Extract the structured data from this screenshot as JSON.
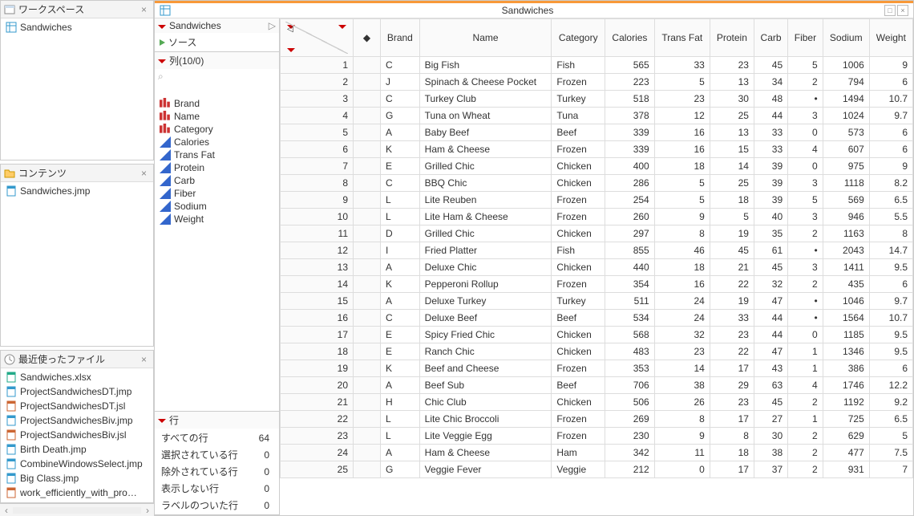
{
  "workspace": {
    "title": "ワークスペース",
    "items": [
      {
        "label": "Sandwiches"
      }
    ]
  },
  "contents": {
    "title": "コンテンツ",
    "items": [
      {
        "label": "Sandwiches.jmp"
      }
    ]
  },
  "recent": {
    "title": "最近使ったファイル",
    "items": [
      {
        "label": "Sandwiches.xlsx",
        "icon": "xlsx"
      },
      {
        "label": "ProjectSandwichesDT.jmp",
        "icon": "jmp"
      },
      {
        "label": "ProjectSandwichesDT.jsl",
        "icon": "jsl"
      },
      {
        "label": "ProjectSandwichesBiv.jmp",
        "icon": "jmp"
      },
      {
        "label": "ProjectSandwichesBiv.jsl",
        "icon": "jsl"
      },
      {
        "label": "Birth Death.jmp",
        "icon": "jmp"
      },
      {
        "label": "CombineWindowsSelect.jmp",
        "icon": "jmp"
      },
      {
        "label": "Big Class.jmp",
        "icon": "jmp"
      },
      {
        "label": "work_efficiently_with_pro…",
        "icon": "jsl"
      }
    ]
  },
  "source_panel": {
    "title": "Sandwiches",
    "items": [
      {
        "label": "ソース"
      }
    ]
  },
  "columns_panel": {
    "title": "列(10/0)",
    "search_placeholder": "",
    "columns": [
      {
        "name": "Brand",
        "type": "nominal"
      },
      {
        "name": "Name",
        "type": "nominal"
      },
      {
        "name": "Category",
        "type": "nominal"
      },
      {
        "name": "Calories",
        "type": "continuous"
      },
      {
        "name": "Trans Fat",
        "type": "continuous"
      },
      {
        "name": "Protein",
        "type": "continuous"
      },
      {
        "name": "Carb",
        "type": "continuous"
      },
      {
        "name": "Fiber",
        "type": "continuous"
      },
      {
        "name": "Sodium",
        "type": "continuous"
      },
      {
        "name": "Weight",
        "type": "continuous"
      }
    ]
  },
  "rows_panel": {
    "title": "行",
    "rows": [
      {
        "label": "すべての行",
        "value": 64
      },
      {
        "label": "選択されている行",
        "value": 0
      },
      {
        "label": "除外されている行",
        "value": 0
      },
      {
        "label": "表示しない行",
        "value": 0
      },
      {
        "label": "ラベルのついた行",
        "value": 0
      }
    ]
  },
  "data_window": {
    "title": "Sandwiches"
  },
  "grid": {
    "headers": [
      "Brand",
      "Name",
      "Category",
      "Calories",
      "Trans Fat",
      "Protein",
      "Carb",
      "Fiber",
      "Sodium",
      "Weight"
    ],
    "col_types": [
      "txt",
      "txt",
      "txt",
      "num",
      "num",
      "num",
      "num",
      "num",
      "num",
      "num"
    ],
    "rows": [
      [
        1,
        "C",
        "Big Fish",
        "Fish",
        565,
        33,
        23,
        45,
        5,
        1006,
        9
      ],
      [
        2,
        "J",
        "Spinach & Cheese Pocket",
        "Frozen",
        223,
        5,
        13,
        34,
        2,
        794,
        6
      ],
      [
        3,
        "C",
        "Turkey Club",
        "Turkey",
        518,
        23,
        30,
        48,
        "•",
        1494,
        10.7
      ],
      [
        4,
        "G",
        "Tuna on Wheat",
        "Tuna",
        378,
        12,
        25,
        44,
        3,
        1024,
        9.7
      ],
      [
        5,
        "A",
        "Baby Beef",
        "Beef",
        339,
        16,
        13,
        33,
        0,
        573,
        6
      ],
      [
        6,
        "K",
        "Ham & Cheese",
        "Frozen",
        339,
        16,
        15,
        33,
        4,
        607,
        6
      ],
      [
        7,
        "E",
        "Grilled Chic",
        "Chicken",
        400,
        18,
        14,
        39,
        0,
        975,
        9
      ],
      [
        8,
        "C",
        "BBQ Chic",
        "Chicken",
        286,
        5,
        25,
        39,
        3,
        1118,
        8.2
      ],
      [
        9,
        "L",
        "Lite Reuben",
        "Frozen",
        254,
        5,
        18,
        39,
        5,
        569,
        6.5
      ],
      [
        10,
        "L",
        "Lite Ham & Cheese",
        "Frozen",
        260,
        9,
        5,
        40,
        3,
        946,
        5.5
      ],
      [
        11,
        "D",
        "Grilled Chic",
        "Chicken",
        297,
        8,
        19,
        35,
        2,
        1163,
        8
      ],
      [
        12,
        "I",
        "Fried Platter",
        "Fish",
        855,
        46,
        45,
        61,
        "•",
        2043,
        14.7
      ],
      [
        13,
        "A",
        "Deluxe Chic",
        "Chicken",
        440,
        18,
        21,
        45,
        3,
        1411,
        9.5
      ],
      [
        14,
        "K",
        "Pepperoni Rollup",
        "Frozen",
        354,
        16,
        22,
        32,
        2,
        435,
        6
      ],
      [
        15,
        "A",
        "Deluxe Turkey",
        "Turkey",
        511,
        24,
        19,
        47,
        "•",
        1046,
        9.7
      ],
      [
        16,
        "C",
        "Deluxe Beef",
        "Beef",
        534,
        24,
        33,
        44,
        "•",
        1564,
        10.7
      ],
      [
        17,
        "E",
        "Spicy Fried Chic",
        "Chicken",
        568,
        32,
        23,
        44,
        0,
        1185,
        9.5
      ],
      [
        18,
        "E",
        "Ranch Chic",
        "Chicken",
        483,
        23,
        22,
        47,
        1,
        1346,
        9.5
      ],
      [
        19,
        "K",
        "Beef and Cheese",
        "Frozen",
        353,
        14,
        17,
        43,
        1,
        386,
        6
      ],
      [
        20,
        "A",
        "Beef Sub",
        "Beef",
        706,
        38,
        29,
        63,
        4,
        1746,
        12.2
      ],
      [
        21,
        "H",
        "Chic Club",
        "Chicken",
        506,
        26,
        23,
        45,
        2,
        1192,
        9.2
      ],
      [
        22,
        "L",
        "Lite Chic Broccoli",
        "Frozen",
        269,
        8,
        17,
        27,
        1,
        725,
        6.5
      ],
      [
        23,
        "L",
        "Lite Veggie Egg",
        "Frozen",
        230,
        9,
        8,
        30,
        2,
        629,
        5
      ],
      [
        24,
        "A",
        "Ham & Cheese",
        "Ham",
        342,
        11,
        18,
        38,
        2,
        477,
        7.5
      ],
      [
        25,
        "G",
        "Veggie Fever",
        "Veggie",
        212,
        0,
        17,
        37,
        2,
        931,
        7
      ]
    ]
  }
}
